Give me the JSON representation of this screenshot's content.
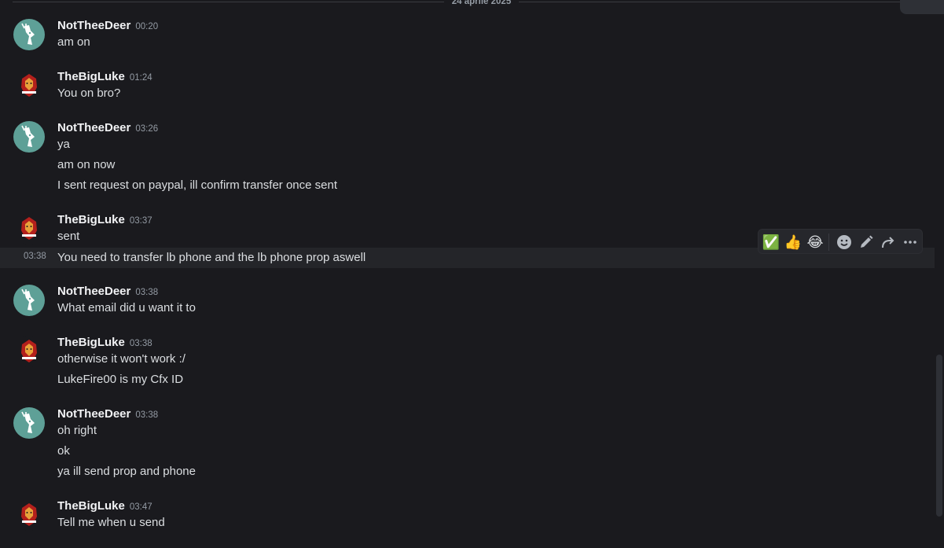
{
  "date_divider": "24 aprile 2025",
  "messages": [
    {
      "author": "NotTheeDeer",
      "time": "00:20",
      "avatar": "deer",
      "lines": [
        "am on"
      ]
    },
    {
      "author": "TheBigLuke",
      "time": "01:24",
      "avatar": "luke",
      "lines": [
        "You on bro?"
      ]
    },
    {
      "author": "NotTheeDeer",
      "time": "03:26",
      "avatar": "deer",
      "lines": [
        "ya",
        "am on now",
        "I sent request on paypal, ill confirm transfer once sent"
      ]
    },
    {
      "author": "TheBigLuke",
      "time": "03:37",
      "avatar": "luke",
      "lines": [
        "sent"
      ]
    },
    {
      "author": "NotTheeDeer",
      "time": "03:38",
      "avatar": "deer",
      "lines": [
        "What email did u want it to"
      ]
    },
    {
      "author": "TheBigLuke",
      "time": "03:38",
      "avatar": "luke",
      "lines": [
        "otherwise it won't work :/",
        "LukeFire00 is my Cfx ID"
      ]
    },
    {
      "author": "NotTheeDeer",
      "time": "03:38",
      "avatar": "deer",
      "lines": [
        "oh right",
        "ok",
        "ya ill send prop and phone"
      ]
    },
    {
      "author": "TheBigLuke",
      "time": "03:47",
      "avatar": "luke",
      "lines": [
        "Tell me when u send"
      ]
    }
  ],
  "hovered_message": {
    "time": "03:38",
    "text": "You need to transfer lb phone and the lb phone prop aswell"
  },
  "toolbar": {
    "reactions": [
      "✅",
      "👍",
      "😂"
    ],
    "actions": [
      {
        "name": "add-reaction",
        "icon": "smiley-icon"
      },
      {
        "name": "edit",
        "icon": "pencil-icon"
      },
      {
        "name": "forward",
        "icon": "forward-arrow-icon"
      },
      {
        "name": "more",
        "icon": "ellipsis-icon"
      }
    ]
  },
  "colors": {
    "background": "#1a1a1e",
    "hover_background": "#242529",
    "deer_avatar": "#5ea097",
    "username": "#f2f3f5",
    "text": "#dbdee1",
    "muted": "#949ba4"
  }
}
